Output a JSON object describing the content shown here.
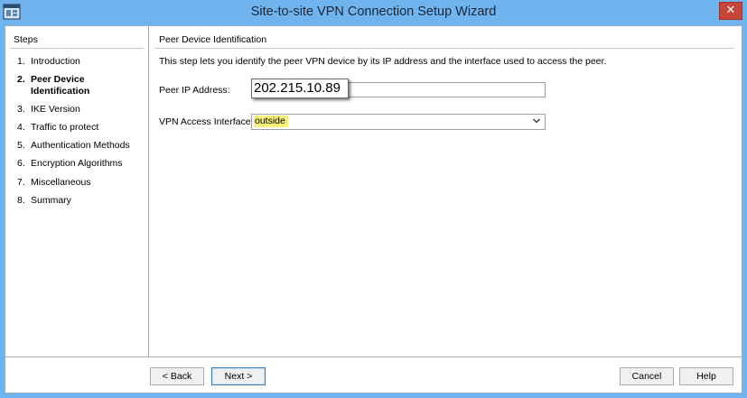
{
  "window": {
    "title": "Site-to-site VPN Connection Setup Wizard",
    "close_symbol": "✕",
    "accent_color": "#6fb4ee",
    "close_color": "#c7453b"
  },
  "sidebar": {
    "title": "Steps",
    "steps": [
      {
        "num": "1.",
        "label": "Introduction",
        "active": false
      },
      {
        "num": "2.",
        "label": "Peer Device Identification",
        "active": true
      },
      {
        "num": "3.",
        "label": "IKE Version",
        "active": false
      },
      {
        "num": "4.",
        "label": "Traffic to protect",
        "active": false
      },
      {
        "num": "5.",
        "label": "Authentication Methods",
        "active": false
      },
      {
        "num": "6.",
        "label": "Encryption Algorithms",
        "active": false
      },
      {
        "num": "7.",
        "label": "Miscellaneous",
        "active": false
      },
      {
        "num": "8.",
        "label": "Summary",
        "active": false
      }
    ]
  },
  "main": {
    "section_title": "Peer Device Identification",
    "intro": "This step lets you identify the peer VPN device by its IP address and the interface used to access the peer.",
    "peer_ip_label": "Peer IP Address:",
    "peer_ip_value": "202.215.10.89",
    "interface_label": "VPN Access Interface:",
    "interface_value": "outside"
  },
  "footer": {
    "back_label": "< Back",
    "next_label": "Next >",
    "cancel_label": "Cancel",
    "help_label": "Help"
  }
}
